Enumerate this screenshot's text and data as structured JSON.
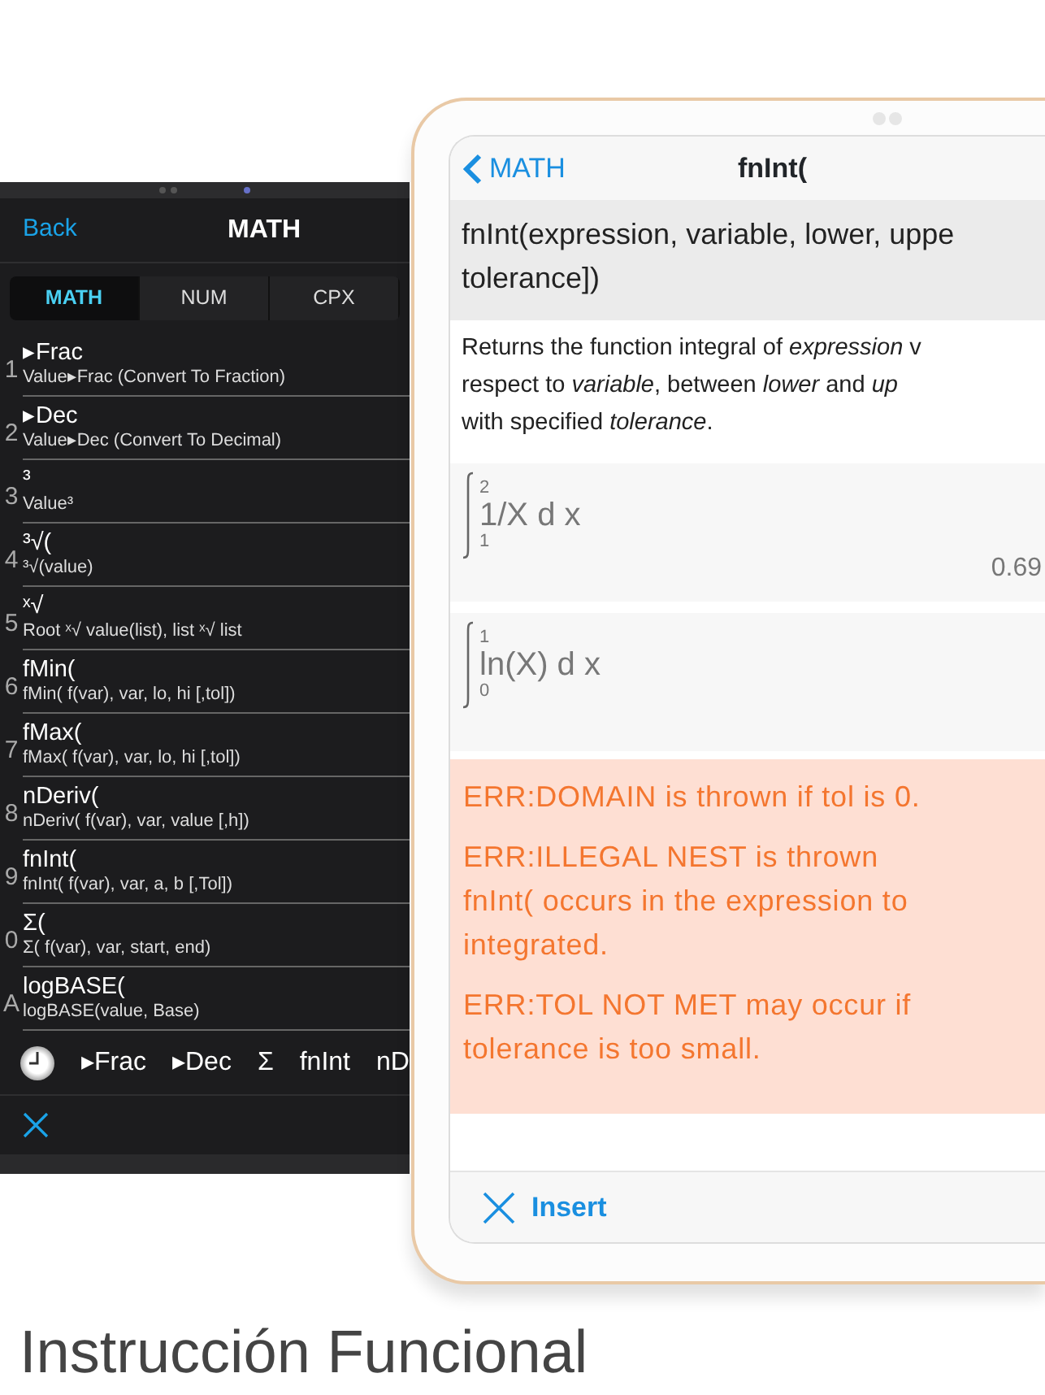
{
  "phone": {
    "back": "Back",
    "title": "MATH",
    "tabs": [
      {
        "label": "MATH",
        "selected": true
      },
      {
        "label": "NUM",
        "selected": false
      },
      {
        "label": "CPX",
        "selected": false
      }
    ],
    "items": [
      {
        "key": "1",
        "title": "▸Frac",
        "subtitle": "Value▸Frac (Convert To Fraction)"
      },
      {
        "key": "2",
        "title": "▸Dec",
        "subtitle": "Value▸Dec (Convert To Decimal)"
      },
      {
        "key": "3",
        "title": "³",
        "subtitle": "Value³"
      },
      {
        "key": "4",
        "title": "³√(",
        "subtitle": "³√(value)"
      },
      {
        "key": "5",
        "title": "ˣ√",
        "subtitle": "Root ˣ√ value(list), list ˣ√ list"
      },
      {
        "key": "6",
        "title": "fMin(",
        "subtitle": "fMin( f(var), var, lo, hi [,tol])"
      },
      {
        "key": "7",
        "title": "fMax(",
        "subtitle": "fMax( f(var), var, lo, hi [,tol])"
      },
      {
        "key": "8",
        "title": "nDeriv(",
        "subtitle": "nDeriv( f(var), var, value [,h])"
      },
      {
        "key": "9",
        "title": "fnInt(",
        "subtitle": "fnInt( f(var), var, a, b [,Tol])"
      },
      {
        "key": "0",
        "title": "Σ(",
        "subtitle": "Σ( f(var), var, start, end)"
      },
      {
        "key": "A",
        "title": "logBASE(",
        "subtitle": "logBASE(value, Base)"
      }
    ],
    "recent": [
      "▸Frac",
      "▸Dec",
      "Σ",
      "fnInt",
      "nD"
    ]
  },
  "tablet": {
    "back": "MATH",
    "title": "fnInt(",
    "syntax": [
      "fnInt(expression, variable, lower, uppe",
      "tolerance])"
    ],
    "description": [
      "Returns the function integral of *expression* v",
      "respect to *variable*, between *lower* and *up*",
      "with specified *tolerance*."
    ],
    "examples": [
      {
        "upper": "2",
        "lower": "1",
        "integrand": "1/X d x",
        "result": "0.69"
      },
      {
        "upper": "1",
        "lower": "0",
        "integrand": "ln(X) d x"
      }
    ],
    "errors": [
      [
        "ERR:DOMAIN is thrown if tol is 0."
      ],
      [
        "ERR:ILLEGAL NEST is thrown",
        "fnInt( occurs in the expression to",
        "integrated."
      ],
      [
        "ERR:TOL NOT MET may occur if",
        "tolerance is too small."
      ]
    ],
    "insert": "Insert"
  },
  "caption": "Instrucción Funcional"
}
